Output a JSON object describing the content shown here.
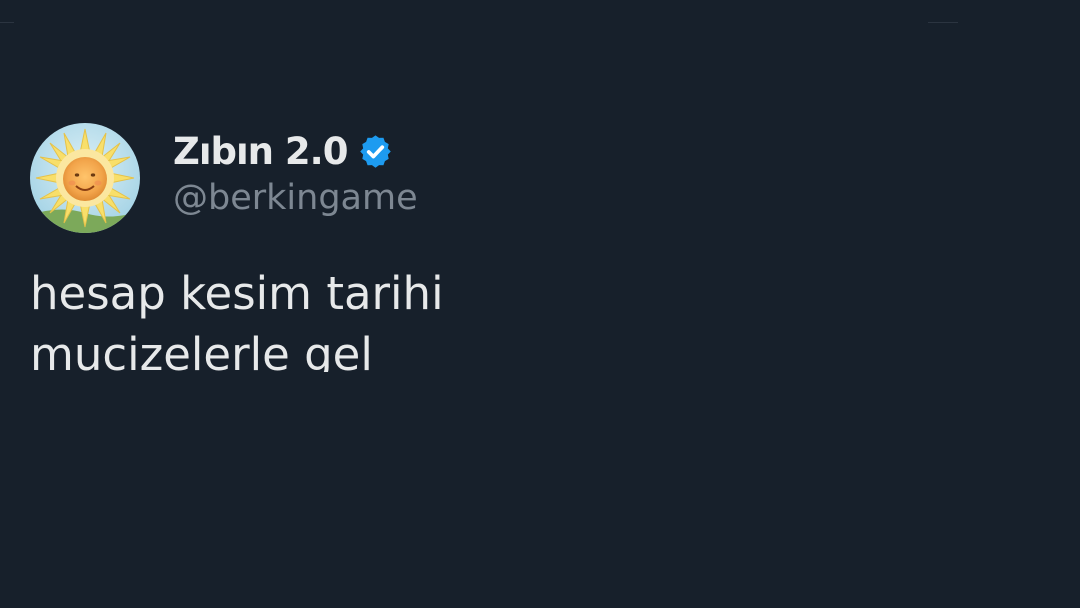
{
  "tweet": {
    "author": {
      "display_name": "Zıbın 2.0",
      "handle": "@berkingame",
      "verified": true,
      "avatar_icon": "sun-baby-avatar-icon",
      "verified_icon": "verified-badge-icon"
    },
    "text_lines": [
      "hesap kesim tarihi",
      "mucizelerle gel"
    ]
  },
  "colors": {
    "background": "#17202b",
    "primary_text": "#e7e9ea",
    "secondary_text": "#7d8792",
    "verified_blue": "#1d9bf0"
  }
}
